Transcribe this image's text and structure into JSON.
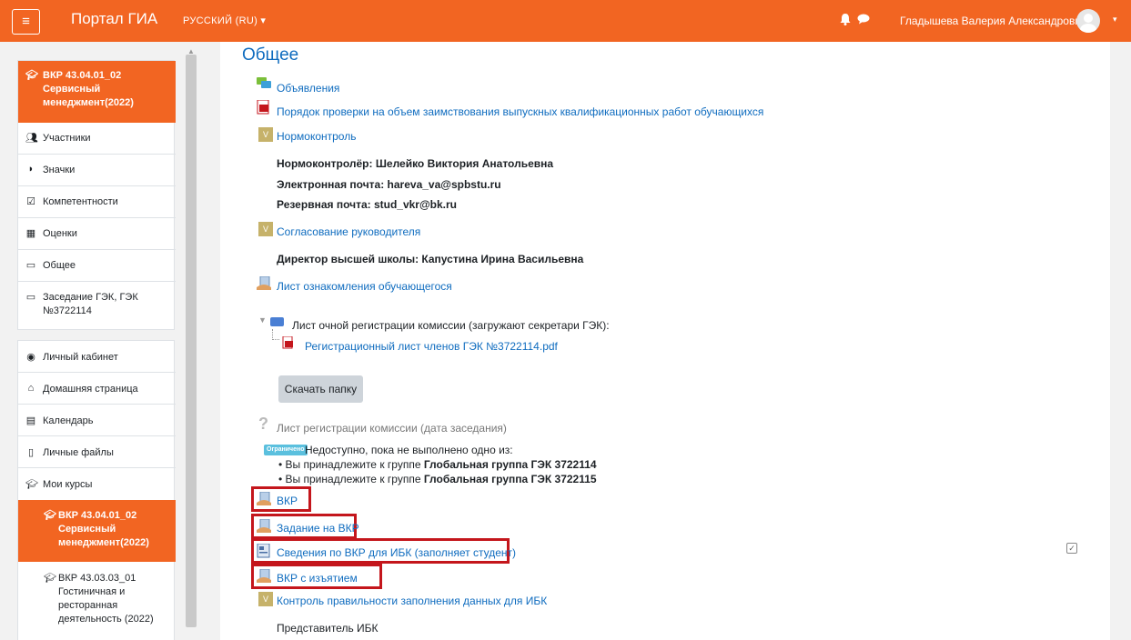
{
  "header": {
    "menu_icon": "hamburger-icon",
    "site_name": "Портал ГИА",
    "language": "РУССКИЙ (RU) ▾",
    "user_name": "Гладышева Валерия Александровна",
    "user_caret": "▾"
  },
  "drawer": {
    "course_items": [
      {
        "label": "ВКР 43.04.01_02 Сервисный менеджмент(2022)",
        "icon": "graduation-cap-icon",
        "active": true
      },
      {
        "label": "Участники",
        "icon": "users-icon"
      },
      {
        "label": "Значки",
        "icon": "shield-icon"
      },
      {
        "label": "Компетентности",
        "icon": "check-square-icon"
      },
      {
        "label": "Оценки",
        "icon": "table-icon"
      },
      {
        "label": "Общее",
        "icon": "folder-icon"
      },
      {
        "label": "Заседание ГЭК, ГЭК №3722114",
        "icon": "folder-icon"
      }
    ],
    "site_items": [
      {
        "label": "Личный кабинет",
        "icon": "dashboard-icon"
      },
      {
        "label": "Домашняя страница",
        "icon": "home-icon"
      },
      {
        "label": "Календарь",
        "icon": "calendar-icon"
      },
      {
        "label": "Личные файлы",
        "icon": "file-icon"
      },
      {
        "label": "Мои курсы",
        "icon": "graduation-cap-icon"
      },
      {
        "label": "ВКР 43.04.01_02 Сервисный менеджмент(2022)",
        "icon": "graduation-cap-icon",
        "active": true
      },
      {
        "label": "ВКР 43.03.03_01 Гостиничная и ресторанная деятельность (2022)",
        "icon": "graduation-cap-icon"
      }
    ]
  },
  "main": {
    "section_title": "Общее",
    "activities": {
      "announcements": "Объявления",
      "check_order": "Порядок проверки на объем заимствования выпускных квалификационных работ обучающихся",
      "normcontrol": "Нормоконтроль",
      "normcontroller": "Нормоконтролёр: Шелейко Виктория Анатольевна",
      "email": "Электронная почта: hareva_va@spbstu.ru",
      "backup_email": "Резервная почта: stud_vkr@bk.ru",
      "supervisor_approval": "Согласование руководителя",
      "director": "Директор высшей школы: Капустина Ирина Васильевна",
      "familiarization_sheet": "Лист ознакомления обучающегося",
      "folder_label": "Лист очной регистрации комиссии (загружают секретари ГЭК):",
      "folder_file": "Регистрационный лист членов ГЭК №3722114.pdf",
      "download_button": "Скачать папку",
      "registration_sheet": "Лист регистрации комиссии (дата заседания)",
      "restricted_badge": "Ограничено",
      "restriction_text": "Недоступно, пока не выполнено одно из:",
      "condition1_prefix": "• Вы принадлежите к группе ",
      "condition1_group": "Глобальная группа ГЭК 3722114",
      "condition2_prefix": "• Вы принадлежите к группе ",
      "condition2_group": "Глобальная группа ГЭК 3722115",
      "vkr": "ВКР",
      "vkr_task": "Задание на ВКР",
      "ibk_info": "Сведения по ВКР для ИБК (заполняет студент)",
      "vkr_redacted": "ВКР с изъятием",
      "ibk_check": "Контроль правильности заполнения данных для ИБК",
      "ibk_rep": "Представитель ИБК"
    }
  },
  "colors": {
    "brand": "#f26522",
    "link": "#0f6cbf",
    "highlight_box": "#c4161c"
  }
}
